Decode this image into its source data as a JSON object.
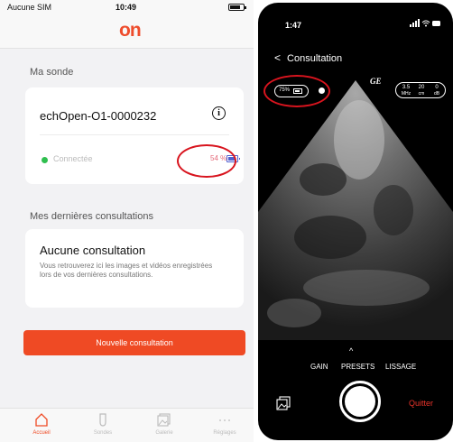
{
  "left_app": {
    "status": {
      "carrier": "Aucune SIM",
      "time": "10:49"
    },
    "logo": "on",
    "probe_section": {
      "title": "Ma sonde",
      "probe_name": "echOpen-O1-0000232",
      "status": "Connectée",
      "battery": "54 %"
    },
    "consultations_section": {
      "title": "Mes dernières consultations",
      "empty_title": "Aucune consultation",
      "empty_text": "Vous retrouverez ici les images et vidéos enregistrées lors de vos dernières consultations."
    },
    "new_button": "Nouvelle consultation",
    "tabs": [
      {
        "label": "Accueil",
        "icon": "home-icon",
        "active": true
      },
      {
        "label": "Sondes",
        "icon": "probe-icon",
        "active": false
      },
      {
        "label": "Galerie",
        "icon": "gallery-icon",
        "active": false
      },
      {
        "label": "Réglages",
        "icon": "more-icon",
        "active": false
      }
    ],
    "colors": {
      "accent": "#ef4a24",
      "connected": "#2fbf4f",
      "highlight": "#d8141e"
    }
  },
  "right_app": {
    "status": {
      "time": "1:47"
    },
    "title": "Consultation",
    "battery": "75%",
    "brand": "GE",
    "params": [
      {
        "value": "3.5",
        "unit": "MHz"
      },
      {
        "value": "20",
        "unit": "cm"
      },
      {
        "value": "0",
        "unit": "dB"
      }
    ],
    "modes": [
      "GAIN",
      "PRESETS",
      "LISSAGE"
    ],
    "quit": "Quitter"
  }
}
